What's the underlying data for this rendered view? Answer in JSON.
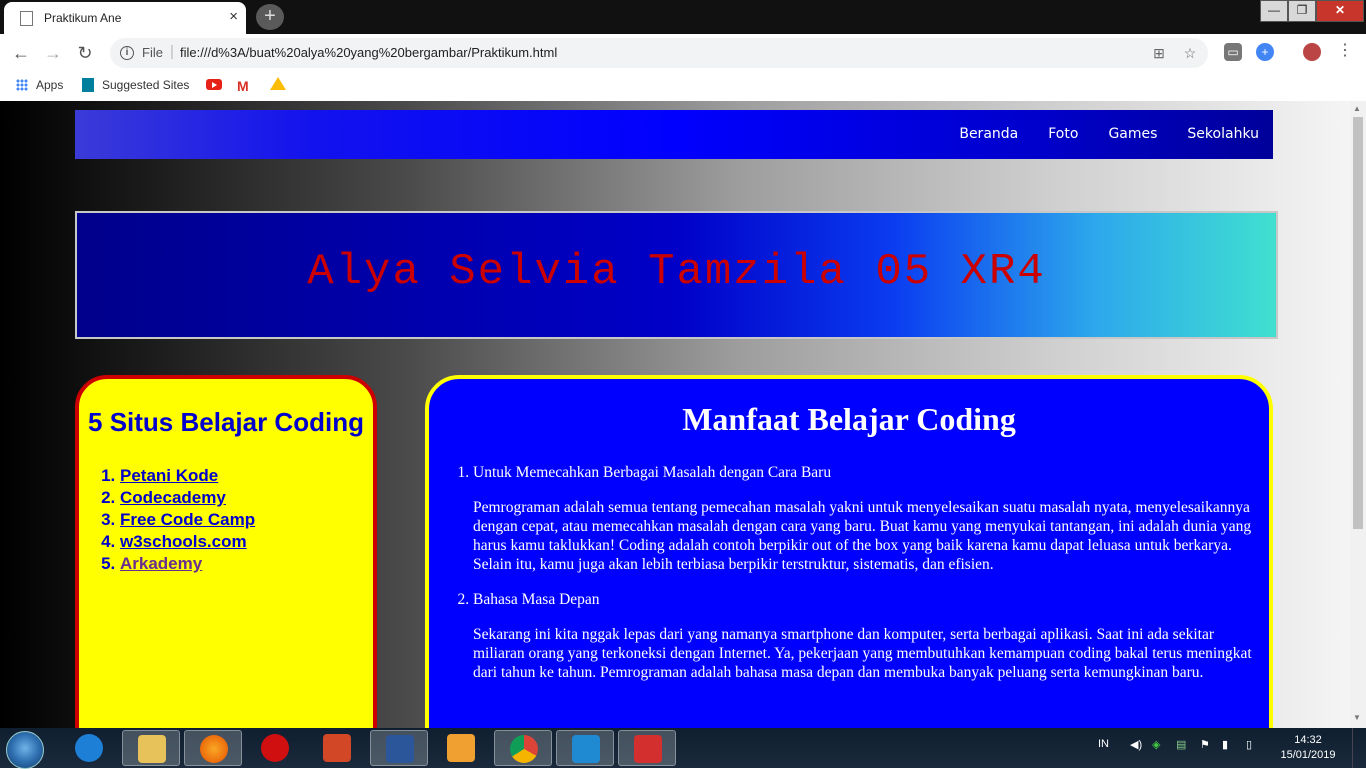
{
  "browser": {
    "tab_title": "Praktikum Ane",
    "tab_close": "×",
    "new_tab": "+",
    "url_scheme": "File",
    "url": "file:///d%3A/buat%20alya%20yang%20bergambar/Praktikum.html",
    "controls": {
      "minimize": "—",
      "maximize": "❐",
      "close": "✕"
    },
    "nav": {
      "back": "←",
      "forward": "→",
      "reload": "↻"
    },
    "bookmarks": {
      "apps": "Apps",
      "suggested": "Suggested Sites"
    }
  },
  "page": {
    "navbar": [
      "Beranda",
      "Foto",
      "Games",
      "Sekolahku"
    ],
    "banner_title": "Alya Selvia Tamzila 05 XR4",
    "sidebar": {
      "title": "5 Situs Belajar Coding",
      "links": [
        "Petani Kode",
        "Codecademy",
        "Free Code Camp",
        "w3schools.com",
        "Arkademy"
      ]
    },
    "main": {
      "title": "Manfaat Belajar Coding",
      "items": [
        {
          "heading": "Untuk Memecahkan Berbagai Masalah dengan Cara Baru",
          "body": "Pemrograman adalah semua tentang pemecahan masalah yakni untuk menyelesaikan suatu masalah nyata, menyelesaikannya dengan cepat, atau memecahkan masalah dengan cara yang baru. Buat kamu yang menyukai tantangan, ini adalah dunia yang harus kamu taklukkan! Coding adalah contoh berpikir out of the box yang baik karena kamu dapat leluasa untuk berkarya. Selain itu, kamu juga akan lebih terbiasa berpikir terstruktur, sistematis, dan efisien."
        },
        {
          "heading": "Bahasa Masa Depan",
          "body": "Sekarang ini kita nggak lepas dari yang namanya smartphone dan komputer, serta berbagai aplikasi. Saat ini ada sekitar miliaran orang yang terkoneksi dengan Internet. Ya, pekerjaan yang membutuhkan kemampuan coding bakal terus meningkat dari tahun ke tahun. Pemrograman adalah bahasa masa depan dan membuka banyak peluang serta kemungkinan baru."
        }
      ]
    }
  },
  "taskbar": {
    "language": "IN",
    "time": "14:32",
    "date": "15/01/2019",
    "apps": [
      "internet-explorer",
      "file-explorer",
      "firefox",
      "opera",
      "powerpoint",
      "word",
      "media-player",
      "chrome",
      "vscode",
      "acrobat"
    ]
  }
}
